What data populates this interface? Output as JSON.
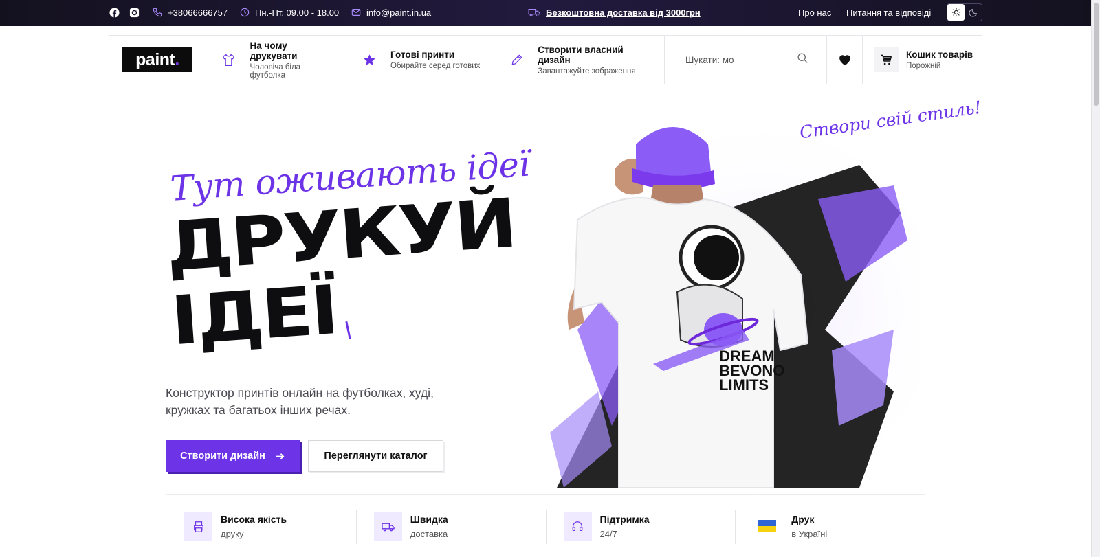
{
  "topbar": {
    "phone": "+38066666757",
    "hours": "Пн.-Пт. 09.00 - 18.00",
    "email": "info@paint.in.ua",
    "delivery": "Безкоштовна доставка від 3000грн",
    "links": [
      "Про нас",
      "Питання та відповіді"
    ]
  },
  "header": {
    "logo_text": "paint",
    "logo_dot": ".",
    "nav": [
      {
        "title": "На чому друкувати",
        "sub": "Чоловіча біла футболка",
        "icon": "tshirt-icon"
      },
      {
        "title": "Готові принти",
        "sub": "Обирайте серед готових",
        "icon": "star-icon"
      },
      {
        "title": "Створити власний дизайн",
        "sub": "Завантажуйте зображення",
        "icon": "pencil-icon"
      }
    ],
    "search_placeholder": "Шукати: мо",
    "cart_title": "Кошик товарів",
    "cart_sub": "Порожній"
  },
  "hero": {
    "script": "Тут оживають ідеї",
    "headline_1": "ДРУКУЙ",
    "headline_2": "ІДЕЇ",
    "subtitle": "Конструктор принтів онлайн на футболках, худі, кружках та багатьох інших речах.",
    "primary_button": "Створити дизайн",
    "secondary_button": "Переглянути каталог",
    "art_script": "Створи свій стиль!",
    "shirt_text": [
      "DREAM",
      "BEVONO",
      "LIMITS"
    ]
  },
  "features": [
    {
      "title": "Висока якість",
      "sub": "друку",
      "icon": "printer-icon"
    },
    {
      "title": "Швидка",
      "sub": "доставка",
      "icon": "truck-icon"
    },
    {
      "title": "Підтримка",
      "sub": "24/7",
      "icon": "headset-icon"
    },
    {
      "title": "Друк",
      "sub": "в Україні",
      "icon": "ukraine-flag-icon"
    }
  ],
  "colors": {
    "accent": "#6d33e6",
    "topbar": "#1d1733",
    "text": "#111111"
  }
}
